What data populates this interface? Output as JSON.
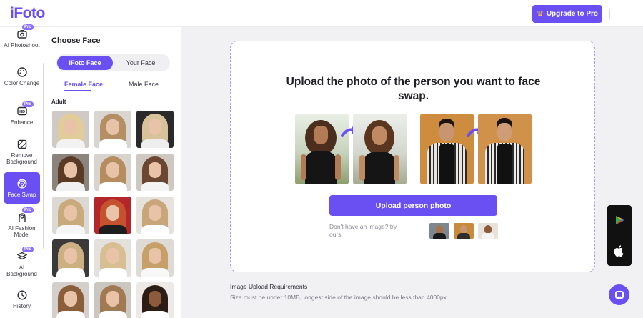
{
  "header": {
    "logo": "iFoto",
    "upgrade_label": "Upgrade to Pro"
  },
  "rail": {
    "items": [
      {
        "label": "AI Photoshoot",
        "icon": "camera-icon",
        "pro": true
      },
      {
        "label": "Color Change",
        "icon": "palette-icon",
        "pro": false
      },
      {
        "label": "Enhance",
        "icon": "hd-icon",
        "pro": true
      },
      {
        "label": "Remove Background",
        "icon": "remove-bg-icon",
        "pro": false
      },
      {
        "label": "Face Swap",
        "icon": "face-swap-icon",
        "pro": false,
        "active": true
      },
      {
        "label": "AI Fashion Model",
        "icon": "fashion-model-icon",
        "pro": true
      },
      {
        "label": "AI Background",
        "icon": "layers-icon",
        "pro": true
      },
      {
        "label": "History",
        "icon": "clock-icon",
        "pro": false
      }
    ],
    "pro_badge": "Pro"
  },
  "face_panel": {
    "title": "Choose Face",
    "segment": {
      "option_a": "iFoto Face",
      "option_b": "Your Face",
      "selected": "iFoto Face"
    },
    "gender_tabs": {
      "female": "Female Face",
      "male": "Male Face",
      "selected": "Female Face"
    },
    "section_label": "Adult"
  },
  "main": {
    "upload_title": "Upload the photo of the person you want to face swap.",
    "upload_button": "Upload person photo",
    "try_text": "Don't have an image? try ours:",
    "requirements_title": "Image Upload Requirements",
    "requirements_text": "Size must be under 10MB, longest side of the image should be less than 4000px"
  },
  "colors": {
    "accent": "#6a4ff2",
    "pro_badge": "#8a6cff"
  }
}
